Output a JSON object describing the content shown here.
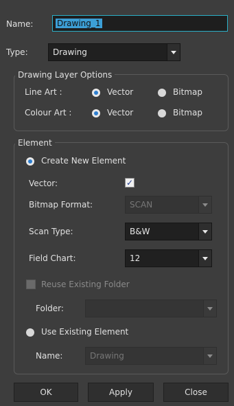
{
  "name_row": {
    "label": "Name:",
    "value": "Drawing_1"
  },
  "type_row": {
    "label": "Type:",
    "value": "Drawing"
  },
  "drawing_layer_options": {
    "title": "Drawing Layer Options",
    "line_art": {
      "label": "Line Art :",
      "opt1": "Vector",
      "opt2": "Bitmap",
      "selected": "Vector"
    },
    "colour_art": {
      "label": "Colour Art :",
      "opt1": "Vector",
      "opt2": "Bitmap",
      "selected": "Vector"
    }
  },
  "element": {
    "title": "Element",
    "create_new": "Create New Element",
    "vector_label": "Vector:",
    "vector_checked": true,
    "vector_mark": "✓",
    "bitmap_format_label": "Bitmap Format:",
    "bitmap_format_value": "SCAN",
    "scan_type_label": "Scan Type:",
    "scan_type_value": "B&W",
    "field_chart_label": "Field Chart:",
    "field_chart_value": "12",
    "reuse_folder": "Reuse Existing Folder",
    "folder_label": "Folder:",
    "folder_value": "",
    "use_existing": "Use Existing Element",
    "existing_name_label": "Name:",
    "existing_name_value": "Drawing"
  },
  "buttons": {
    "ok": "OK",
    "apply": "Apply",
    "close": "Close"
  }
}
